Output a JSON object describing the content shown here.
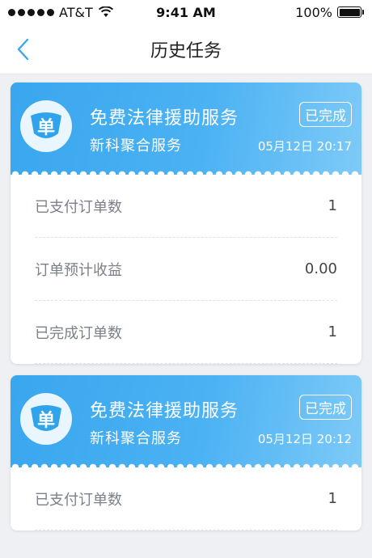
{
  "status_bar": {
    "carrier": "AT&T",
    "time": "9:41 AM",
    "battery": "100%"
  },
  "nav": {
    "title": "历史任务"
  },
  "colors": {
    "accent": "#3aa6ee",
    "header_light": "#7ecaf7"
  },
  "cards": [
    {
      "logo_text": "单",
      "title": "免费法律援助服务",
      "subtitle": "新科聚合服务",
      "status": "已完成",
      "time": "05月12日 20:17",
      "stats": [
        {
          "label": "已支付订单数",
          "value": "1"
        },
        {
          "label": "订单预计收益",
          "value": "0.00"
        },
        {
          "label": "已完成订单数",
          "value": "1"
        }
      ]
    },
    {
      "logo_text": "单",
      "title": "免费法律援助服务",
      "subtitle": "新科聚合服务",
      "status": "已完成",
      "time": "05月12日 20:12",
      "stats": [
        {
          "label": "已支付订单数",
          "value": "1"
        }
      ]
    }
  ]
}
